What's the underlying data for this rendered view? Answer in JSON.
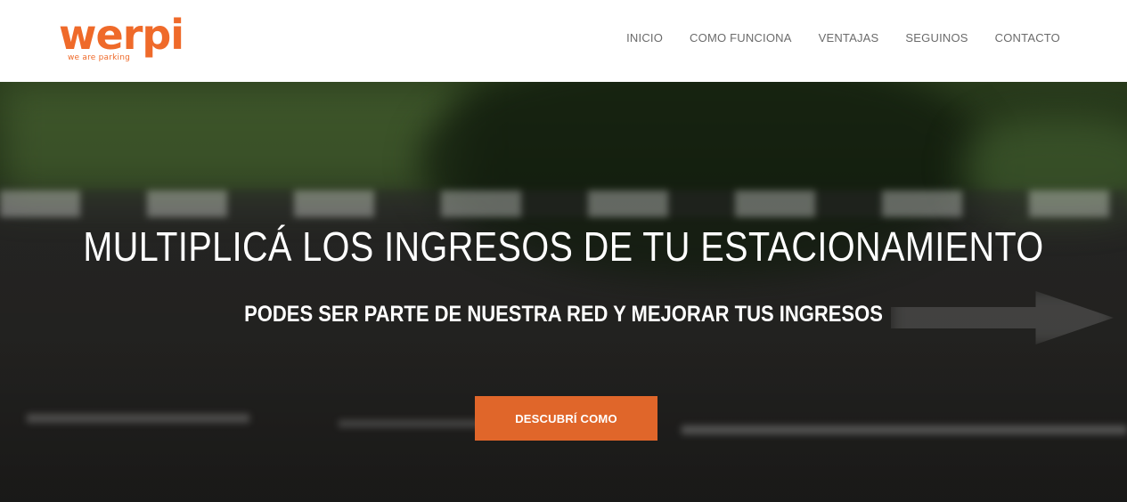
{
  "brand": {
    "logo_text": "werpi",
    "tagline": "we are parking",
    "color": "#ef6a2a"
  },
  "nav": {
    "items": [
      {
        "label": "INICIO"
      },
      {
        "label": "COMO FUNCIONA"
      },
      {
        "label": "VENTAJAS"
      },
      {
        "label": "SEGUINOS"
      },
      {
        "label": "CONTACTO"
      }
    ]
  },
  "hero": {
    "title": "MULTIPLICÁ LOS INGRESOS DE TU ESTACIONAMIENTO",
    "subtitle": "PODES SER PARTE DE NUESTRA RED Y MEJORAR TUS INGRESOS",
    "cta_label": "DESCUBRÍ COMO",
    "cta_color": "#e0662a"
  }
}
